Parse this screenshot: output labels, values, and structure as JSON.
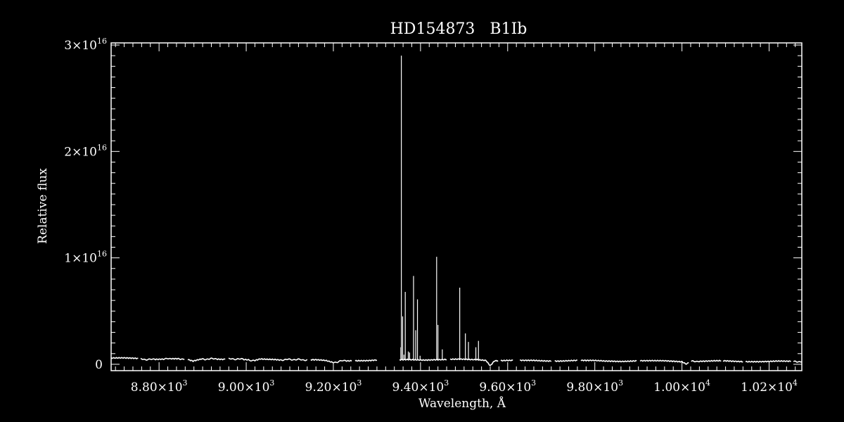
{
  "chart_data": {
    "type": "line",
    "title": "HD154873   B1Ib",
    "xlabel": "Wavelength, Å",
    "ylabel": "Relative flux",
    "xlim": [
      8690,
      10275
    ],
    "ylim": [
      -600000000000000.0,
      3.02e+16
    ],
    "x_ticks": [
      8800,
      9000,
      9200,
      9400,
      9600,
      9800,
      10000,
      10200
    ],
    "x_tick_labels": [
      {
        "mant": "8.80",
        "exp": "3"
      },
      {
        "mant": "9.00",
        "exp": "3"
      },
      {
        "mant": "9.20",
        "exp": "3"
      },
      {
        "mant": "9.40",
        "exp": "3"
      },
      {
        "mant": "9.60",
        "exp": "3"
      },
      {
        "mant": "9.80",
        "exp": "3"
      },
      {
        "mant": "1.00",
        "exp": "4"
      },
      {
        "mant": "1.02",
        "exp": "4"
      }
    ],
    "y_ticks": [
      0,
      1e+16,
      2e+16,
      3e+16
    ],
    "y_tick_labels": [
      {
        "mant": "0",
        "exp": ""
      },
      {
        "mant": "1",
        "exp": "16"
      },
      {
        "mant": "2",
        "exp": "16"
      },
      {
        "mant": "3",
        "exp": "16"
      }
    ],
    "colors": {
      "background": "#000000",
      "line": "#ffffff"
    },
    "series": [
      {
        "continuum_segments": [
          {
            "x": [
              8690,
              8720,
              8760,
              8775,
              8790,
              8810,
              8825,
              8845,
              8862,
              8878,
              8898,
              8915,
              8932,
              8948,
              8965,
              8980,
              8995,
              9005,
              9018,
              9032,
              9050,
              9066,
              9078,
              9095,
              9110,
              9125,
              9140,
              9160,
              9170,
              9182,
              9200,
              9215,
              9228,
              9242,
              9260,
              9280,
              9300
            ],
            "y": [
              580000000000000.0,
              560000000000000.0,
              520000000000000.0,
              420000000000000.0,
              500000000000000.0,
              520000000000000.0,
              500000000000000.0,
              540000000000000.0,
              460000000000000.0,
              260000000000000.0,
              480000000000000.0,
              500000000000000.0,
              510000000000000.0,
              500000000000000.0,
              490000000000000.0,
              500000000000000.0,
              460000000000000.0,
              440000000000000.0,
              300000000000000.0,
              460000000000000.0,
              440000000000000.0,
              450000000000000.0,
              420000000000000.0,
              440000000000000.0,
              450000000000000.0,
              430000000000000.0,
              410000000000000.0,
              400000000000000.0,
              360000000000000.0,
              320000000000000.0,
              140000000000000.0,
              300000000000000.0,
              340000000000000.0,
              360000000000000.0,
              370000000000000.0,
              360000000000000.0,
              390000000000000.0
            ]
          },
          {
            "x": [
              9352,
              9370,
              9390,
              9410,
              9430,
              9450,
              9470,
              9490,
              9510,
              9530,
              9550,
              9560,
              9570,
              9590,
              9610,
              9640,
              9660,
              9680,
              9700,
              9720,
              9740,
              9760,
              9780,
              9800,
              9820,
              9840,
              9860,
              9880,
              9900,
              9920,
              9940,
              9960,
              9980,
              10000,
              10010,
              10025,
              10040,
              10060,
              10080,
              10100,
              10120,
              10140,
              10160,
              10180,
              10200,
              10220,
              10240,
              10260,
              10275
            ],
            "y": [
              400000000000000.0,
              450000000000000.0,
              450000000000000.0,
              430000000000000.0,
              440000000000000.0,
              420000000000000.0,
              430000000000000.0,
              450000000000000.0,
              440000000000000.0,
              450000000000000.0,
              400000000000000.0,
              -100000000000000.0,
              360000000000000.0,
              350000000000000.0,
              340000000000000.0,
              330000000000000.0,
              350000000000000.0,
              340000000000000.0,
              340000000000000.0,
              330000000000000.0,
              340000000000000.0,
              340000000000000.0,
              320000000000000.0,
              330000000000000.0,
              310000000000000.0,
              320000000000000.0,
              300000000000000.0,
              310000000000000.0,
              320000000000000.0,
              300000000000000.0,
              300000000000000.0,
              310000000000000.0,
              300000000000000.0,
              270000000000000.0,
              60000000000000.0,
              280000000000000.0,
              290000000000000.0,
              280000000000000.0,
              290000000000000.0,
              290000000000000.0,
              280000000000000.0,
              270000000000000.0,
              280000000000000.0,
              270000000000000.0,
              260000000000000.0,
              270000000000000.0,
              250000000000000.0,
              260000000000000.0,
              250000000000000.0
            ]
          }
        ],
        "gaps_x": [
          [
            8752,
            8757
          ],
          [
            8860,
            8866
          ],
          [
            8952,
            8958
          ],
          [
            9140,
            9148
          ],
          [
            9242,
            9250
          ],
          [
            9300,
            9352
          ],
          [
            9460,
            9467
          ],
          [
            9578,
            9583
          ],
          [
            9612,
            9628
          ],
          [
            9700,
            9707
          ],
          [
            9760,
            9767
          ],
          [
            9896,
            9904
          ],
          [
            10016,
            10020
          ],
          [
            10090,
            10094
          ],
          [
            10140,
            10146
          ],
          [
            10250,
            10255
          ]
        ],
        "spikes": [
          {
            "x": 9356,
            "y": 2.9e+16
          },
          {
            "x": 9355,
            "y": 1600000000000000.0
          },
          {
            "x": 9359,
            "y": 4500000000000000.0
          },
          {
            "x": 9365,
            "y": 6800000000000000.0
          },
          {
            "x": 9372,
            "y": 1200000000000000.0
          },
          {
            "x": 9378,
            "y": 350000000000000.0
          },
          {
            "x": 9384,
            "y": 8300000000000000.0
          },
          {
            "x": 9389,
            "y": 3200000000000000.0
          },
          {
            "x": 9393,
            "y": 6100000000000000.0
          },
          {
            "x": 9399,
            "y": 800000000000000.0
          },
          {
            "x": 9437,
            "y": 1.01e+16
          },
          {
            "x": 9440,
            "y": 3700000000000000.0
          },
          {
            "x": 9450,
            "y": 1400000000000000.0
          },
          {
            "x": 9490,
            "y": 7200000000000000.0
          },
          {
            "x": 9503,
            "y": 2900000000000000.0
          },
          {
            "x": 9510,
            "y": 2100000000000000.0
          },
          {
            "x": 9527,
            "y": 1600000000000000.0
          },
          {
            "x": 9533,
            "y": 2200000000000000.0
          },
          {
            "x": 9548,
            "y": 400000000000000.0
          },
          {
            "x": 9362,
            "y": 900000000000000.0
          },
          {
            "x": 9375,
            "y": 1100000000000000.0
          }
        ]
      }
    ]
  }
}
